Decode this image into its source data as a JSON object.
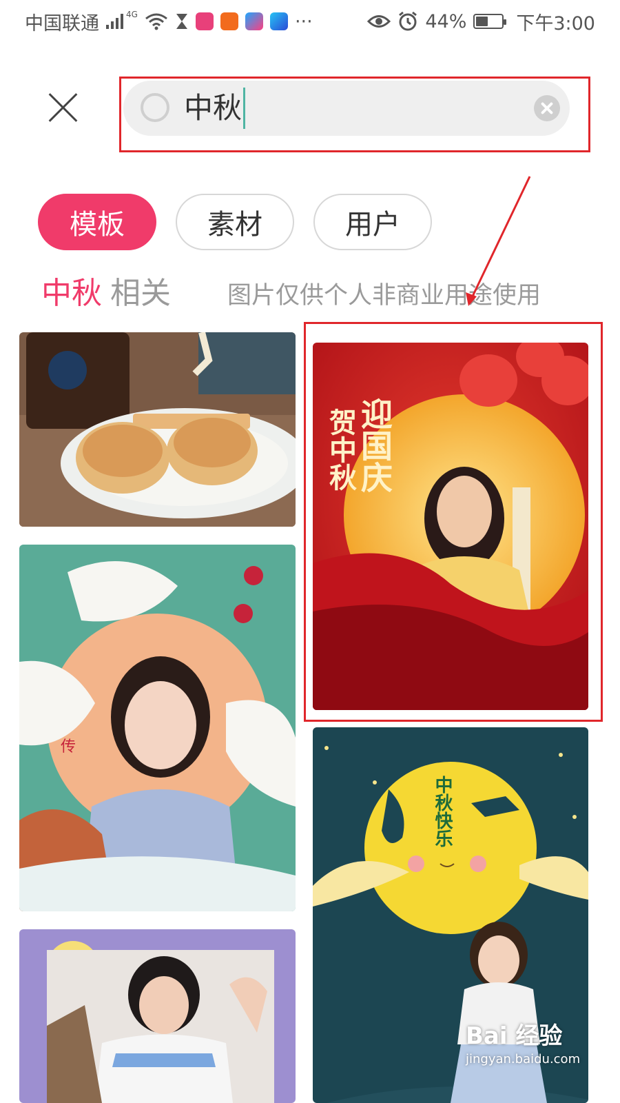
{
  "status_bar": {
    "carrier": "中国联通",
    "network": "4G",
    "battery": "44%",
    "time": "下午3:00",
    "more": "···"
  },
  "search": {
    "query": "中秋"
  },
  "tabs": [
    {
      "label": "模板",
      "active": true
    },
    {
      "label": "素材",
      "active": false
    },
    {
      "label": "用户",
      "active": false
    }
  ],
  "related": {
    "keyword": "中秋",
    "suffix": "相关",
    "note": "图片仅供个人非商业用途使用"
  },
  "results": {
    "card2_text_a": "迎国庆",
    "card2_text_b": "贺中秋",
    "card4_text": "中秋快乐",
    "card3_text": "传"
  },
  "watermark": {
    "brand": "Bai 经验",
    "url": "jingyan.baidu.com"
  },
  "colors": {
    "accent": "#f03b6a",
    "highlight": "#e0262b",
    "caret": "#4fb5a3"
  }
}
